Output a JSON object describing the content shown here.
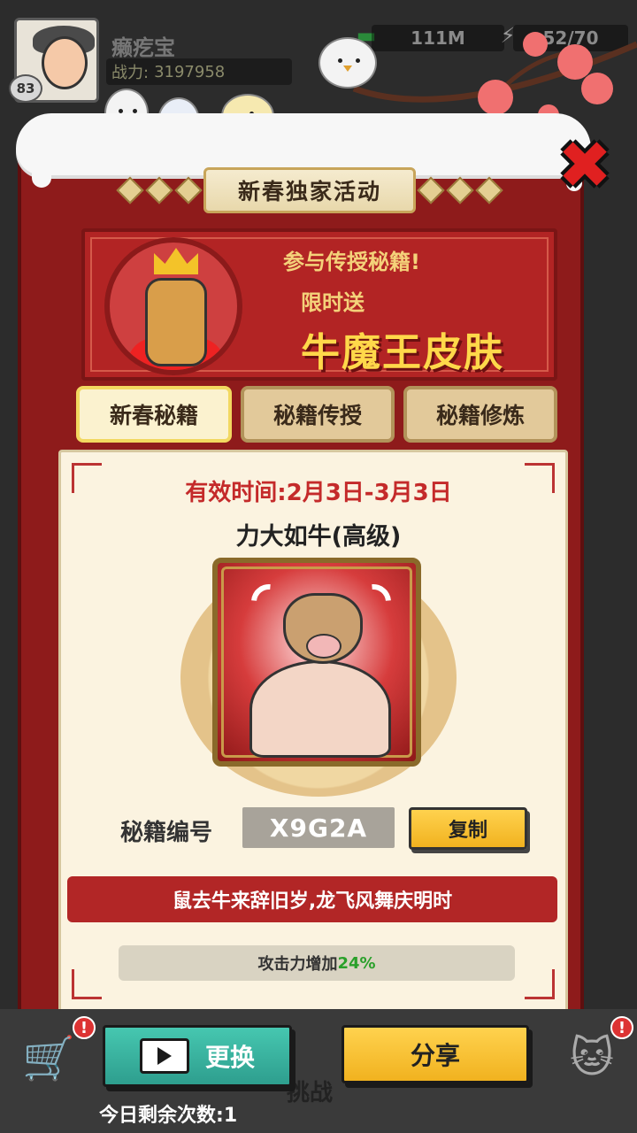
{
  "header": {
    "player_name": "癞疙宝",
    "power_label": "战力:",
    "power_value": "3197958",
    "level": "83",
    "money": "111M",
    "energy": "52/70"
  },
  "modal": {
    "title": "新春独家活动",
    "close_icon": "close-x",
    "banner": {
      "line1": "参与传授秘籍!",
      "line2": "限时送",
      "line3": "牛魔王皮肤"
    },
    "tabs": [
      {
        "label": "新春秘籍",
        "active": true
      },
      {
        "label": "秘籍传授",
        "active": false
      },
      {
        "label": "秘籍修炼",
        "active": false
      }
    ],
    "valid_time": "有效时间:2月3日-3月3日",
    "skill_name": "力大如牛(高级)",
    "code_label": "秘籍编号",
    "code_value": "X9G2A",
    "copy_label": "复制",
    "poem": "鼠去牛来辞旧岁,龙飞风舞庆明时",
    "bonus_text": "攻击力增加",
    "bonus_pct": "24%"
  },
  "footer": {
    "swap_label": "更换",
    "share_label": "分享",
    "challenge_label": "挑战",
    "remaining_label": "今日剩余次数:",
    "remaining_value": "1",
    "alert_mark": "!"
  },
  "colors": {
    "modal_red": "#8e1b1b",
    "gold": "#ffd84a",
    "teal": "#2e9e8e",
    "bonus_green": "#2aa02a"
  }
}
